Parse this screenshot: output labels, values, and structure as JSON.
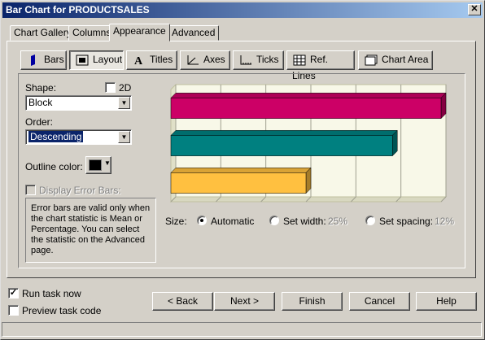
{
  "window": {
    "title": "Bar Chart for PRODUCTSALES",
    "close_glyph": "✕"
  },
  "tabs": [
    {
      "label": "Chart Gallery"
    },
    {
      "label": "Columns"
    },
    {
      "label": "Appearance"
    },
    {
      "label": "Advanced"
    }
  ],
  "subtabs": [
    {
      "label": "Bars",
      "icon": "bars-icon"
    },
    {
      "label": "Layout",
      "icon": "layout-icon"
    },
    {
      "label": "Titles",
      "icon": "titles-icon"
    },
    {
      "label": "Axes",
      "icon": "axes-icon"
    },
    {
      "label": "Ticks",
      "icon": "ticks-icon"
    },
    {
      "label": "Ref. Lines",
      "icon": "reflines-icon"
    },
    {
      "label": "Chart Area",
      "icon": "chartarea-icon"
    }
  ],
  "layout": {
    "shape_label": "Shape:",
    "two_d_label": "2D",
    "shape_value": "Block",
    "order_label": "Order:",
    "order_value": "Descending",
    "outline_label": "Outline color:",
    "outline_color": "#000000",
    "error_bars_label": "Display Error Bars:",
    "info_text": "Error bars are valid only when the chart statistic is Mean or Percentage.  You can select the statistic on the Advanced page."
  },
  "size": {
    "label": "Size:",
    "automatic_label": "Automatic",
    "set_width_label": "Set width:",
    "set_width_value": "25%",
    "set_spacing_label": "Set spacing:",
    "set_spacing_value": "12%"
  },
  "chart_data": {
    "type": "bar",
    "orientation": "horizontal",
    "values": [
      100,
      82,
      50
    ],
    "colors": [
      "#cc0066",
      "#008080",
      "#ffc040"
    ],
    "xlim": [
      0,
      100
    ],
    "grid": true
  },
  "footer": {
    "run_task_label": "Run task now",
    "run_task_checked": true,
    "preview_label": "Preview task code",
    "preview_checked": false,
    "back_label": "< Back",
    "next_label": "Next >",
    "finish_label": "Finish",
    "cancel_label": "Cancel",
    "help_label": "Help"
  }
}
